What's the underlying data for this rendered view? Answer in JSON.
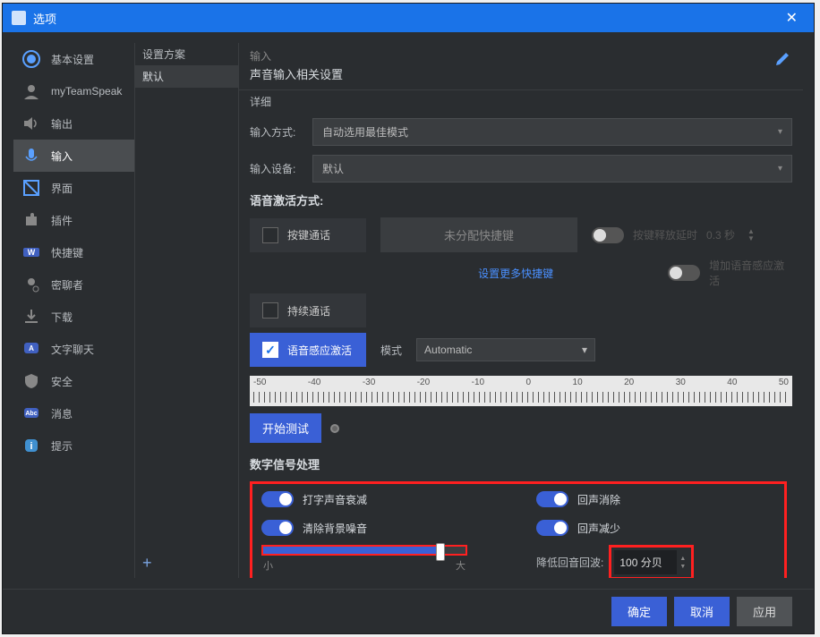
{
  "titlebar": {
    "title": "选项"
  },
  "sidebar": {
    "items": [
      {
        "label": "基本设置"
      },
      {
        "label": "myTeamSpeak"
      },
      {
        "label": "输出"
      },
      {
        "label": "输入"
      },
      {
        "label": "界面"
      },
      {
        "label": "插件"
      },
      {
        "label": "快捷键"
      },
      {
        "label": "密聊者"
      },
      {
        "label": "下载"
      },
      {
        "label": "文字聊天"
      },
      {
        "label": "安全"
      },
      {
        "label": "消息"
      },
      {
        "label": "提示"
      }
    ]
  },
  "profile": {
    "header": "设置方案",
    "default": "默认"
  },
  "main": {
    "crumb": "输入",
    "subtitle": "声音输入相关设置",
    "detail": "详细",
    "input_mode_label": "输入方式:",
    "input_mode_value": "自动选用最佳模式",
    "input_device_label": "输入设备:",
    "input_device_value": "默认",
    "voice_activation_title": "语音激活方式:",
    "ptt_label": "按键通话",
    "hotkey_placeholder": "未分配快捷键",
    "ptt_delay_label": "按键释放延时",
    "ptt_delay_value": "0.3 秒",
    "more_hotkeys": "设置更多快捷键",
    "add_vad_label": "增加语音感应激活",
    "continuous_label": "持续通话",
    "vad_label": "语音感应激活",
    "mode_label": "模式",
    "mode_value": "Automatic",
    "ruler_labels": [
      "-50",
      "-40",
      "-30",
      "-20",
      "-10",
      "0",
      "10",
      "20",
      "30",
      "40",
      "50"
    ],
    "start_test": "开始测试",
    "dsp_title": "数字信号处理",
    "typing_atten": "打字声音衰减",
    "echo_cancel": "回声消除",
    "noise_remove": "清除背景噪音",
    "echo_reduce": "回声减少",
    "slider_small": "小",
    "slider_big": "大",
    "echo_reduce_label": "降低回音回波:",
    "echo_value": "100 分贝"
  },
  "footer": {
    "ok": "确定",
    "cancel": "取消",
    "apply": "应用"
  }
}
